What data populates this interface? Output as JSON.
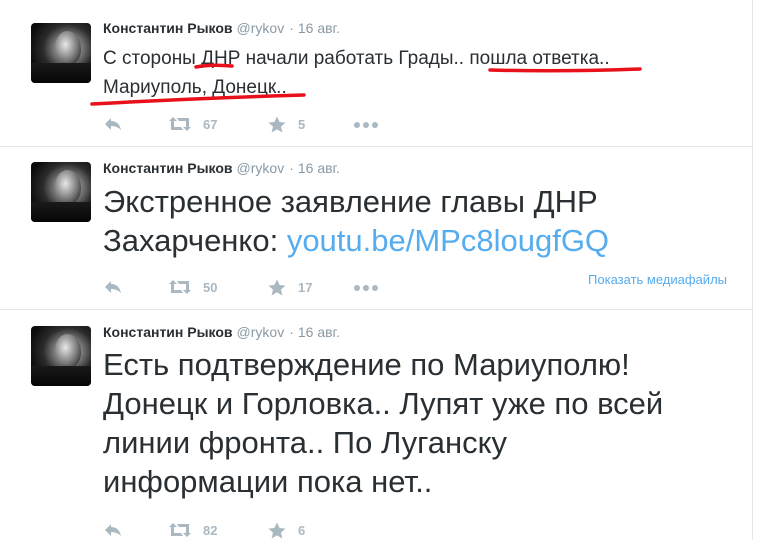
{
  "tweets": [
    {
      "author": "Константин Рыков",
      "handle": "@rykov",
      "date": "16 авг.",
      "text_line1": "С стороны ДНР начали работать Грады.. пошла ответка..",
      "text_line2": "Мариуполь, Донецк..",
      "retweets": "67",
      "favorites": "5"
    },
    {
      "author": "Константин Рыков",
      "handle": "@rykov",
      "date": "16 авг.",
      "text_line1": "Экстренное заявление главы ДНР",
      "text_prefix": "Захарченко: ",
      "link": "youtu.be/MPc8lougfGQ",
      "retweets": "50",
      "favorites": "17",
      "media_link": "Показать медиафайлы"
    },
    {
      "author": "Константин Рыков",
      "handle": "@rykov",
      "date": "16 авг.",
      "text_line1": "Есть подтверждение по Мариуполю!",
      "text_line2": "Донецк и Горловка.. Лупят уже по всей",
      "text_line3": "линии фронта.. По Луганску",
      "text_line4": "информации пока нет..",
      "retweets": "82",
      "favorites": "6"
    }
  ],
  "colors": {
    "link": "#55acee",
    "icon": "#aab8c2",
    "underline": "#e8101a"
  },
  "icons": [
    "reply-icon",
    "retweet-icon",
    "favorite-icon",
    "more-icon"
  ]
}
